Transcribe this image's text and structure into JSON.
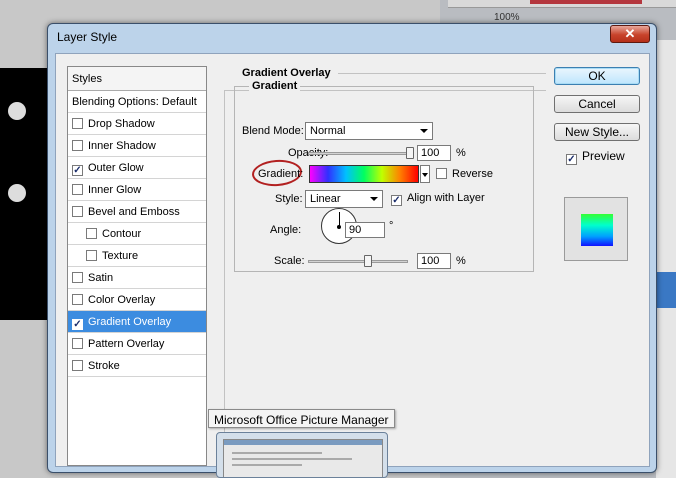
{
  "background": {
    "zoom_label": "100%"
  },
  "dialog": {
    "title": "Layer Style",
    "close_glyph": "✕"
  },
  "styles_list": {
    "header": "Styles",
    "items": [
      {
        "label": "Blending Options: Default",
        "checkbox": false,
        "checked": false,
        "indent": false,
        "selected": false
      },
      {
        "label": "Drop Shadow",
        "checkbox": true,
        "checked": false,
        "indent": false,
        "selected": false
      },
      {
        "label": "Inner Shadow",
        "checkbox": true,
        "checked": false,
        "indent": false,
        "selected": false
      },
      {
        "label": "Outer Glow",
        "checkbox": true,
        "checked": true,
        "indent": false,
        "selected": false
      },
      {
        "label": "Inner Glow",
        "checkbox": true,
        "checked": false,
        "indent": false,
        "selected": false
      },
      {
        "label": "Bevel and Emboss",
        "checkbox": true,
        "checked": false,
        "indent": false,
        "selected": false
      },
      {
        "label": "Contour",
        "checkbox": true,
        "checked": false,
        "indent": true,
        "selected": false
      },
      {
        "label": "Texture",
        "checkbox": true,
        "checked": false,
        "indent": true,
        "selected": false
      },
      {
        "label": "Satin",
        "checkbox": true,
        "checked": false,
        "indent": false,
        "selected": false
      },
      {
        "label": "Color Overlay",
        "checkbox": true,
        "checked": false,
        "indent": false,
        "selected": false
      },
      {
        "label": "Gradient Overlay",
        "checkbox": true,
        "checked": true,
        "indent": false,
        "selected": true
      },
      {
        "label": "Pattern Overlay",
        "checkbox": true,
        "checked": false,
        "indent": false,
        "selected": false
      },
      {
        "label": "Stroke",
        "checkbox": true,
        "checked": false,
        "indent": false,
        "selected": false
      }
    ]
  },
  "gradient_overlay": {
    "section_title": "Gradient Overlay",
    "group_title": "Gradient",
    "blend_mode_label": "Blend Mode:",
    "blend_mode_value": "Normal",
    "opacity_label": "Opacity:",
    "opacity_value": "100",
    "opacity_level": 100,
    "percent": "%",
    "gradient_label": "Gradient:",
    "reverse_label": "Reverse",
    "reverse_checked": false,
    "style_label": "Style:",
    "style_value": "Linear",
    "align_label": "Align with Layer",
    "align_checked": true,
    "angle_label": "Angle:",
    "angle_value": "90",
    "degree": "°",
    "scale_label": "Scale:",
    "scale_value": "100",
    "scale_level": 100,
    "gradient_colors": [
      "#ff00ff",
      "#3030ff",
      "#00c0ff",
      "#00ff60",
      "#c0ff00",
      "#ff8000",
      "#ff0000"
    ],
    "annotation_color": "#b22020"
  },
  "buttons": {
    "ok": "OK",
    "cancel": "Cancel",
    "new_style": "New Style...",
    "preview_label": "Preview",
    "preview_checked": true
  },
  "taskbar": {
    "tooltip": "Microsoft Office Picture Manager"
  },
  "check_glyph": "✓"
}
